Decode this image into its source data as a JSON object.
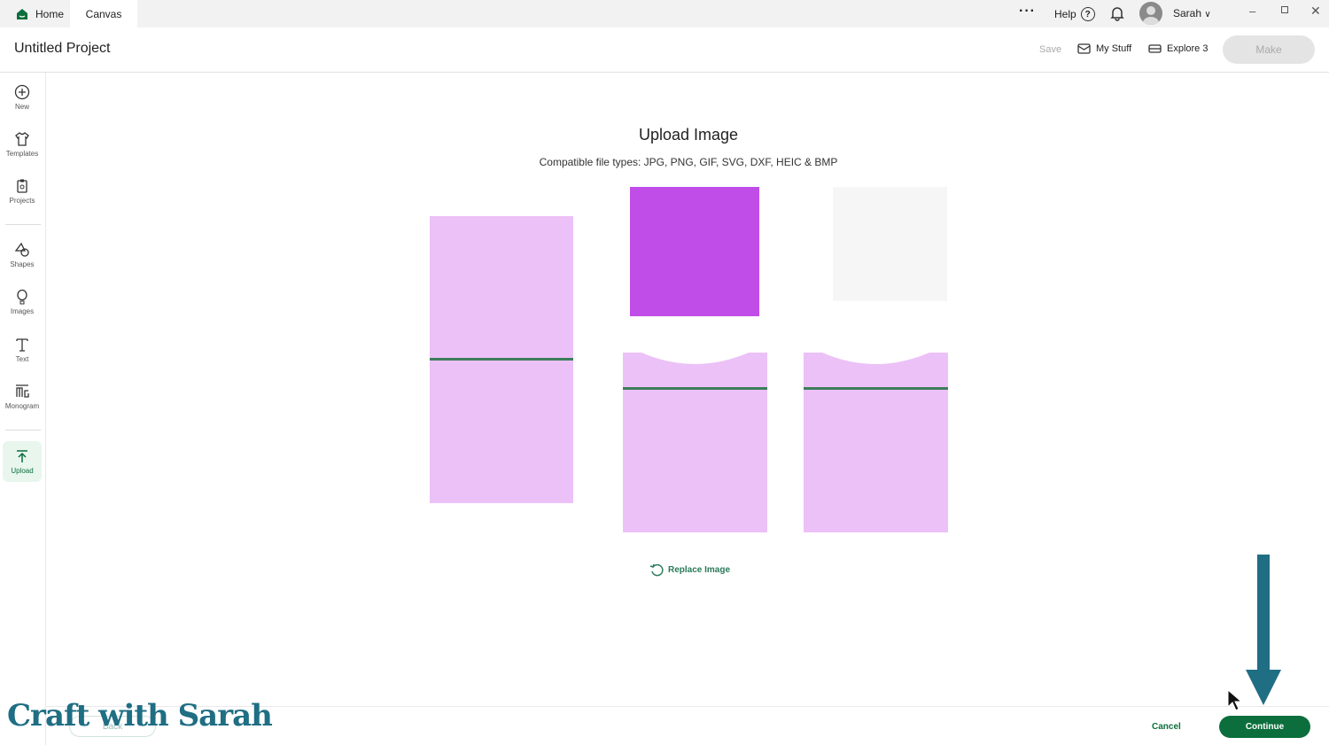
{
  "tabs": {
    "home": "Home",
    "canvas": "Canvas"
  },
  "topbar": {
    "help": "Help",
    "user": "Sarah"
  },
  "header": {
    "title": "Untitled Project",
    "save": "Save",
    "my_stuff": "My Stuff",
    "machine": "Explore 3",
    "make": "Make"
  },
  "sidebar": [
    {
      "label": "New"
    },
    {
      "label": "Templates"
    },
    {
      "label": "Projects"
    },
    {
      "label": "Shapes"
    },
    {
      "label": "Images"
    },
    {
      "label": "Text"
    },
    {
      "label": "Monogram"
    },
    {
      "label": "Upload"
    }
  ],
  "upload": {
    "title": "Upload Image",
    "subtitle": "Compatible file types:  JPG, PNG, GIF, SVG, DXF, HEIC & BMP",
    "replace": "Replace Image"
  },
  "footer": {
    "back": "Back",
    "cancel": "Cancel",
    "continue": "Continue"
  },
  "watermark": "Craft with Sarah",
  "colors": {
    "accent": "#0b6e3c",
    "pink": "#ecc1f7",
    "purple": "#c14de8",
    "arrow": "#1f6e84"
  }
}
